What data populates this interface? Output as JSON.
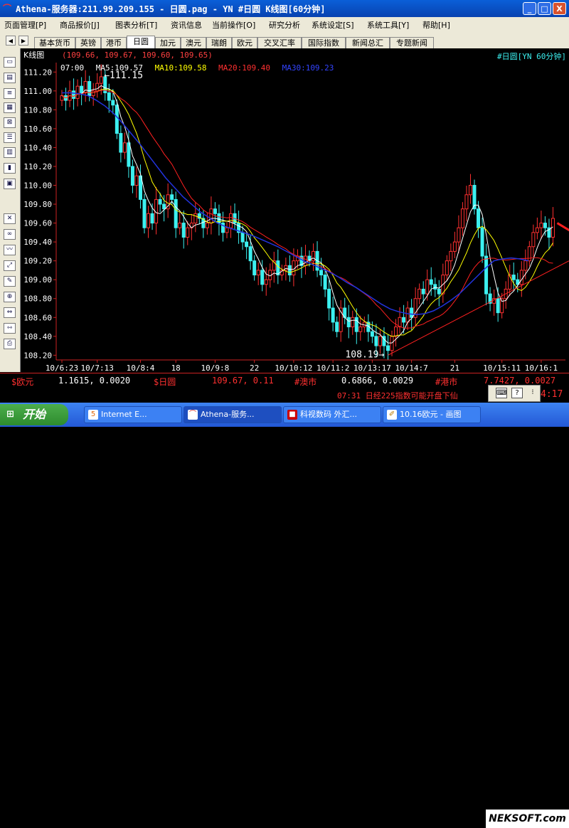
{
  "window": {
    "title": "Athena-服务器:211.99.209.155  - 日圆.pag - YN #日圆 K线图[60分钟]",
    "min_label": "_",
    "max_label": "□",
    "close_label": "X"
  },
  "menu": [
    "页面管理[P]",
    "商品报价[J]",
    "图表分析[T]",
    "资讯信息",
    "当前操作[O]",
    "研究分析",
    "系统设定[S]",
    "系统工具[Y]",
    "帮助[H]"
  ],
  "tabs": {
    "items": [
      "基本货币",
      "英镑",
      "港币",
      "日圆",
      "加元",
      "澳元",
      "瑞朗",
      "欧元",
      "交叉汇率",
      "国际指数",
      "新闻总汇",
      "专题新闻"
    ],
    "active_index": 3
  },
  "chart": {
    "kline_label": "K线图",
    "ohlc": "(109.66, 109.67, 109.60, 109.65)",
    "symbol": "#日圆[YN 60分钟]",
    "ma_time": "07:00",
    "ma5": "MA5:109.57",
    "ma10": "MA10:109.58",
    "ma20": "MA20:109.40",
    "ma30": "MA30:109.23",
    "high_label": "111.15",
    "low_label": "108.19",
    "colors": {
      "up": "#ff3030",
      "down": "#3cf0f0",
      "ma5": "#ffffff",
      "ma10": "#ffff00",
      "ma20": "#ff2020",
      "ma30": "#2233dd",
      "trend": "#ff2020"
    }
  },
  "chart_data": {
    "type": "candlestick",
    "title": "#日圆[YN 60分钟]",
    "ylim": [
      108.15,
      111.3
    ],
    "y_ticks": [
      "111.20",
      "111.00",
      "110.80",
      "110.60",
      "110.40",
      "110.20",
      "110.00",
      "109.80",
      "109.60",
      "109.40",
      "109.20",
      "109.00",
      "108.80",
      "108.60",
      "108.40",
      "108.20"
    ],
    "x_ticks": [
      "10/6:23",
      "10/7:13",
      "10/8:4",
      "18",
      "10/9:8",
      "22",
      "10/10:12",
      "10/11:2",
      "10/13:17",
      "10/14:7",
      "21",
      "10/15:11",
      "10/16:1"
    ],
    "series_close": [
      110.95,
      110.9,
      111.0,
      110.92,
      111.05,
      110.98,
      111.1,
      110.95,
      111.0,
      111.08,
      111.15,
      110.98,
      110.9,
      110.85,
      110.55,
      110.35,
      110.45,
      110.2,
      110.0,
      110.1,
      109.85,
      109.55,
      109.7,
      109.6,
      109.85,
      109.8,
      109.75,
      109.9,
      109.85,
      109.55,
      109.6,
      109.45,
      109.55,
      109.6,
      109.7,
      109.65,
      109.55,
      109.6,
      109.75,
      109.7,
      109.6,
      109.5,
      109.55,
      109.7,
      109.6,
      109.5,
      109.4,
      109.35,
      109.2,
      109.05,
      109.1,
      108.95,
      109.0,
      109.1,
      109.2,
      109.05,
      109.1,
      109.15,
      109.05,
      109.2,
      109.25,
      109.15,
      109.25,
      109.2,
      109.3,
      109.1,
      109.05,
      108.9,
      108.7,
      108.55,
      108.45,
      108.7,
      108.6,
      108.5,
      108.6,
      108.45,
      108.5,
      108.55,
      108.45,
      108.4,
      108.3,
      108.4,
      108.3,
      108.25,
      108.4,
      108.5,
      108.6,
      108.55,
      108.7,
      108.6,
      108.8,
      108.9,
      108.85,
      109.0,
      108.95,
      108.9,
      108.85,
      109.05,
      109.2,
      109.3,
      109.4,
      109.55,
      109.75,
      109.9,
      110.0,
      109.75,
      109.55,
      109.25,
      108.85,
      108.75,
      108.8,
      108.65,
      108.8,
      108.9,
      109.05,
      109.0,
      108.95,
      109.1,
      109.2,
      109.35,
      109.5,
      109.55,
      109.6,
      109.55,
      109.45,
      109.65
    ],
    "ma30": [
      110.98,
      110.98,
      110.97,
      110.95,
      110.9,
      110.84,
      110.76,
      110.66,
      110.55,
      110.44,
      110.32,
      110.2,
      110.08,
      109.98,
      109.88,
      109.8,
      109.72,
      109.66,
      109.6,
      109.56,
      109.53,
      109.5,
      109.47,
      109.43,
      109.39,
      109.35,
      109.3,
      109.25,
      109.2,
      109.16,
      109.12,
      109.08,
      109.03,
      108.97,
      108.92,
      108.86,
      108.8,
      108.74,
      108.69,
      108.66,
      108.64,
      108.63,
      108.64,
      108.67,
      108.72,
      108.78,
      108.85,
      108.94,
      109.03,
      109.12,
      109.2,
      109.22,
      109.23,
      109.22,
      109.2
    ],
    "annotations": [
      "111.15",
      "108.19"
    ],
    "trendline": "support line from 108.19 low rising to right edge",
    "arrow": "red up arrow at right end"
  },
  "quotes": {
    "eur_label": "$欧元",
    "eur_val": "1.1615, 0.0020",
    "jpy_label": "$日圆",
    "jpy_val": "109.67, 0.11",
    "aud_label": "#澳市",
    "aud_val": "0.6866, 0.0029",
    "hkd_label": "#港市",
    "hkd_val": "7.7427, 0.0027"
  },
  "news": {
    "text": "07:31 日经225指数可能开盘下仙",
    "clock": "4:17"
  },
  "taskbar": {
    "start": "开始",
    "tasks": [
      "Internet E...",
      "Athena-服务...",
      "科视数码 外汇...",
      "10.16欧元 - 画图"
    ],
    "watermark": "NEKSOFT.com"
  }
}
